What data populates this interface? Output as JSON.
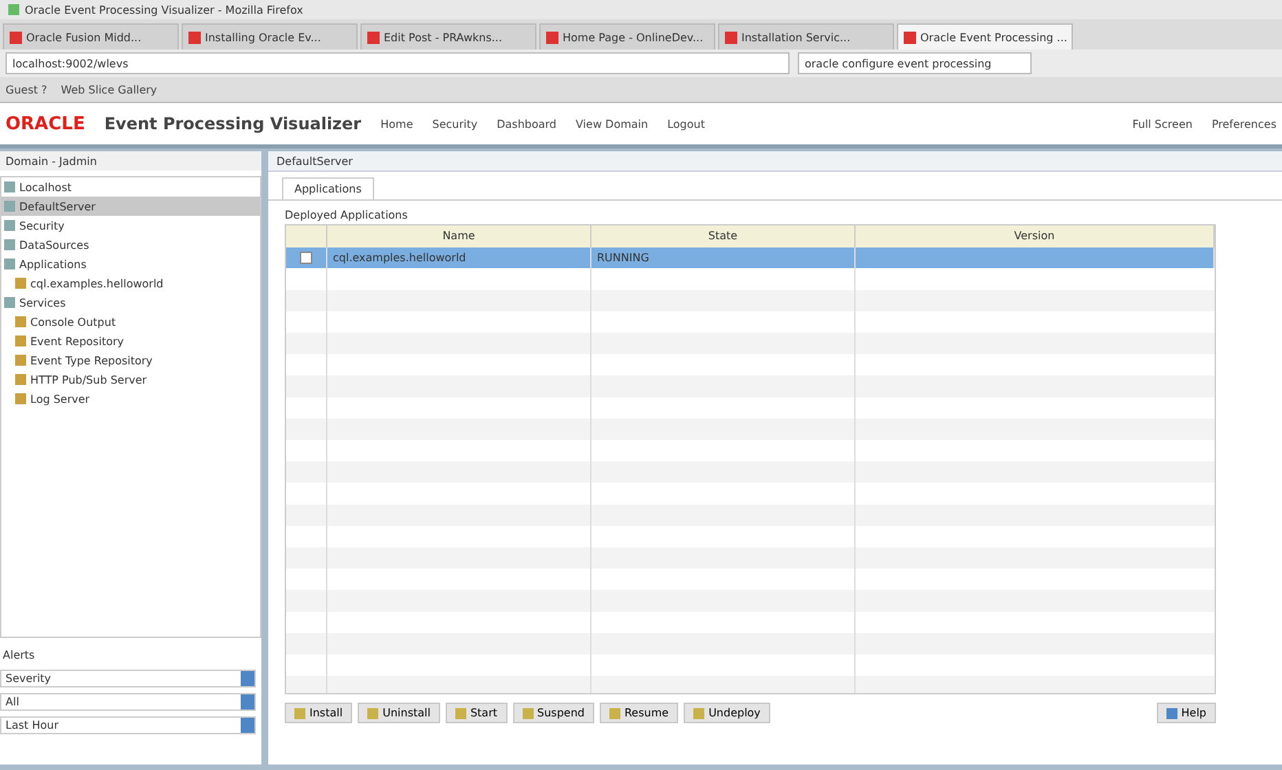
{
  "window": {
    "title": "Oracle Event Processing Visualizer - Mozilla Firefox"
  },
  "browser_tabs": [
    {
      "label": "Oracle Fusion Midd...",
      "selected": false
    },
    {
      "label": "Installing Oracle Ev...",
      "selected": false
    },
    {
      "label": "Edit Post - PRAwkns...",
      "selected": false
    },
    {
      "label": "Home Page - OnlineDev...",
      "selected": false
    },
    {
      "label": "Installation Servic...",
      "selected": false
    },
    {
      "label": "Oracle Event Processing ...",
      "selected": true
    }
  ],
  "address_bar": {
    "value": "localhost:9002/wlevs"
  },
  "search_field": {
    "value": "oracle configure event processing"
  },
  "bookmarks": [
    {
      "label": "Guest ?"
    },
    {
      "label": "Web Slice Gallery"
    }
  ],
  "app": {
    "logo": "ORACLE",
    "title": "Event Processing Visualizer",
    "menu": [
      {
        "label": "Home"
      },
      {
        "label": "Security"
      },
      {
        "label": "Dashboard"
      },
      {
        "label": "View Domain"
      },
      {
        "label": "Logout"
      }
    ],
    "menu_right": [
      {
        "label": "Full Screen"
      },
      {
        "label": "Preferences"
      }
    ]
  },
  "sidebar": {
    "title": "Domain - Jadmin",
    "items": [
      {
        "label": "Localhost",
        "selected": false
      },
      {
        "label": "DefaultServer",
        "selected": true
      },
      {
        "label": "Security",
        "selected": false
      },
      {
        "label": "DataSources",
        "selected": false
      },
      {
        "label": "Applications",
        "selected": false,
        "children": [
          {
            "label": "cql.examples.helloworld",
            "selected": false
          }
        ]
      },
      {
        "label": "Services",
        "selected": false,
        "children": [
          {
            "label": "Console Output",
            "selected": false
          },
          {
            "label": "Event Repository",
            "selected": false
          },
          {
            "label": "Event Type Repository",
            "selected": false
          },
          {
            "label": "HTTP Pub/Sub Server",
            "selected": false
          },
          {
            "label": "Log Server",
            "selected": false
          }
        ]
      }
    ]
  },
  "filters": {
    "title": "Alerts",
    "selects": [
      {
        "value": "Severity"
      },
      {
        "value": "All"
      },
      {
        "value": "Last Hour"
      }
    ]
  },
  "panel": {
    "title": "DefaultServer",
    "tabs": [
      {
        "label": "Applications",
        "selected": true
      }
    ],
    "caption": "Deployed Applications",
    "table": {
      "columns": [
        "Name",
        "State",
        "Version"
      ],
      "rows": [
        {
          "cells": [
            "cql.examples.helloworld",
            "RUNNING"
          ],
          "selected": true,
          "checked": false
        }
      ]
    },
    "actions": [
      {
        "label": "Install"
      },
      {
        "label": "Uninstall"
      },
      {
        "label": "Start"
      },
      {
        "label": "Suspend"
      },
      {
        "label": "Resume"
      },
      {
        "label": "Undeploy"
      }
    ],
    "help": {
      "label": "Help"
    }
  }
}
